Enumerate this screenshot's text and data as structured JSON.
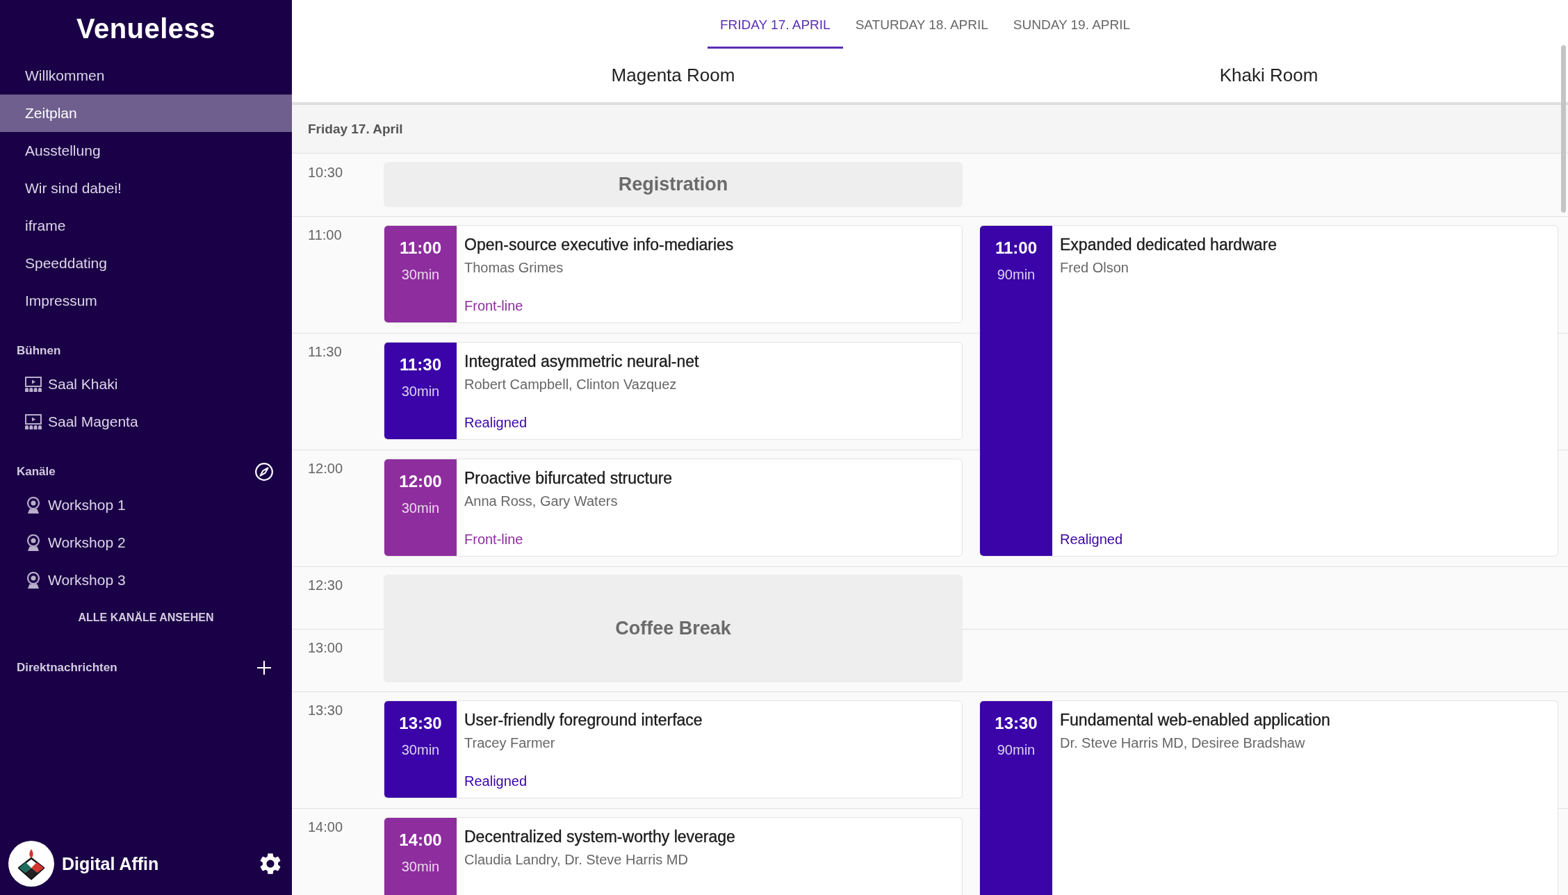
{
  "sidebar": {
    "logo": "Venueless",
    "nav": [
      {
        "label": "Willkommen",
        "selected": false
      },
      {
        "label": "Zeitplan",
        "selected": true
      },
      {
        "label": "Ausstellung",
        "selected": false
      },
      {
        "label": "Wir sind dabei!",
        "selected": false
      },
      {
        "label": "iframe",
        "selected": false
      },
      {
        "label": "Speeddating",
        "selected": false
      },
      {
        "label": "Impressum",
        "selected": false
      }
    ],
    "stages": {
      "title": "Bühnen",
      "items": [
        {
          "label": "Saal Khaki",
          "selected": false
        },
        {
          "label": "Saal Magenta",
          "selected": false
        }
      ]
    },
    "channels": {
      "title": "Kanäle",
      "items": [
        {
          "label": "Workshop 1",
          "selected": false
        },
        {
          "label": "Workshop 2",
          "selected": false
        },
        {
          "label": "Workshop 3",
          "selected": false
        }
      ],
      "browse_all": "ALLE KANÄLE ANSEHEN"
    },
    "direct_messages": {
      "title": "Direktnachrichten"
    },
    "user": {
      "name": "Digital Affin"
    }
  },
  "day_tabs": [
    {
      "label": "FRIDAY 17. APRIL",
      "selected": true
    },
    {
      "label": "SATURDAY 18. APRIL",
      "selected": false
    },
    {
      "label": "SUNDAY 19. APRIL",
      "selected": false
    }
  ],
  "rooms": [
    "Magenta Room",
    "Khaki Room"
  ],
  "schedule": {
    "day_heading": "Friday 17. April",
    "slots": [
      {
        "time": "10:30",
        "cells": [
          {
            "kind": "break",
            "title": "Registration"
          },
          {
            "kind": "empty"
          }
        ]
      },
      {
        "time": "11:00",
        "cells": [
          {
            "kind": "talk",
            "time": "11:00",
            "duration": "30min",
            "title": "Open-source executive info-mediaries",
            "speakers": "Thomas Grimes",
            "track": "Front-line",
            "color": "#8e2d9e"
          },
          {
            "kind": "talk",
            "time": "11:00",
            "duration": "90min",
            "title": "Expanded dedicated hardware",
            "speakers": "Fred Olson",
            "track": "Realigned",
            "color": "#3a04a8"
          }
        ]
      },
      {
        "time": "11:30",
        "cells": [
          {
            "kind": "talk",
            "time": "11:30",
            "duration": "30min",
            "title": "Integrated asymmetric neural-net",
            "speakers": "Robert Campbell, Clinton Vazquez",
            "track": "Realigned",
            "color": "#3a04a8"
          },
          {
            "kind": "continued"
          }
        ]
      },
      {
        "time": "12:00",
        "cells": [
          {
            "kind": "talk",
            "time": "12:00",
            "duration": "30min",
            "title": "Proactive bifurcated structure",
            "speakers": "Anna Ross, Gary Waters",
            "track": "Front-line",
            "color": "#8e2d9e"
          },
          {
            "kind": "continued"
          }
        ]
      },
      {
        "time": "12:30",
        "cells": [
          {
            "kind": "break",
            "title": "Coffee Break"
          },
          {
            "kind": "empty"
          }
        ]
      },
      {
        "time": "13:00",
        "cells": [
          {
            "kind": "continued"
          },
          {
            "kind": "empty"
          }
        ]
      },
      {
        "time": "13:30",
        "cells": [
          {
            "kind": "talk",
            "time": "13:30",
            "duration": "30min",
            "title": "User-friendly foreground interface",
            "speakers": "Tracey Farmer",
            "track": "Realigned",
            "color": "#3a04a8"
          },
          {
            "kind": "talk",
            "time": "13:30",
            "duration": "90min",
            "title": "Fundamental web-enabled application",
            "speakers": "Dr. Steve Harris MD, Desiree Bradshaw",
            "color": "#3a04a8"
          }
        ]
      },
      {
        "time": "14:00",
        "cells": [
          {
            "kind": "talk",
            "time": "14:00",
            "duration": "30min",
            "title": "Decentralized system-worthy leverage",
            "speakers": "Claudia Landry, Dr. Steve Harris MD",
            "color": "#8e2d9e"
          },
          {
            "kind": "continued"
          }
        ]
      }
    ]
  }
}
